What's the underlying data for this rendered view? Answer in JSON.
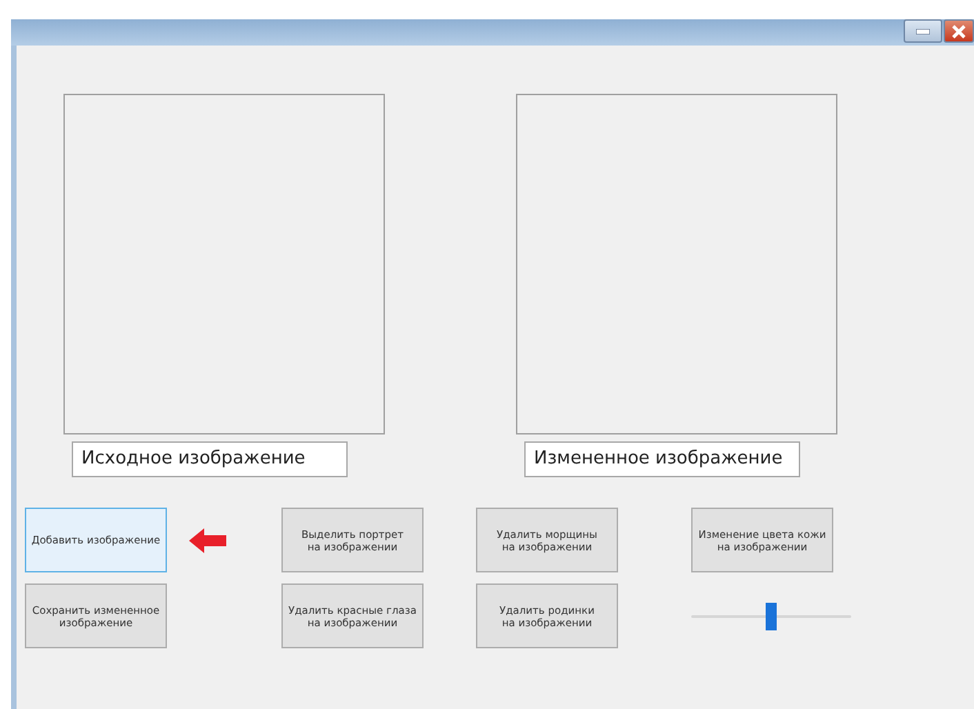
{
  "window": {
    "buttons": [
      {
        "kind": "minimize"
      },
      {
        "kind": "close"
      }
    ]
  },
  "images": [
    {
      "caption": "Исходное изображение"
    },
    {
      "caption": "Измененное изображение"
    }
  ],
  "buttons": [
    {
      "label": "Добавить изображение",
      "focused": true
    },
    {
      "label": "Выделить портрет\nна изображении",
      "focused": false
    },
    {
      "label": "Удалить морщины\nна изображении",
      "focused": false
    },
    {
      "label": "Изменение цвета кожи\nна изображении",
      "focused": false
    },
    {
      "label": "Сохранить измененное\nизображение",
      "focused": false
    },
    {
      "label": "Удалить красные глаза\nна изображении",
      "focused": false
    },
    {
      "label": "Удалить родинки\nна изображении",
      "focused": false
    }
  ],
  "skin_slider": {
    "level": 0.5
  }
}
